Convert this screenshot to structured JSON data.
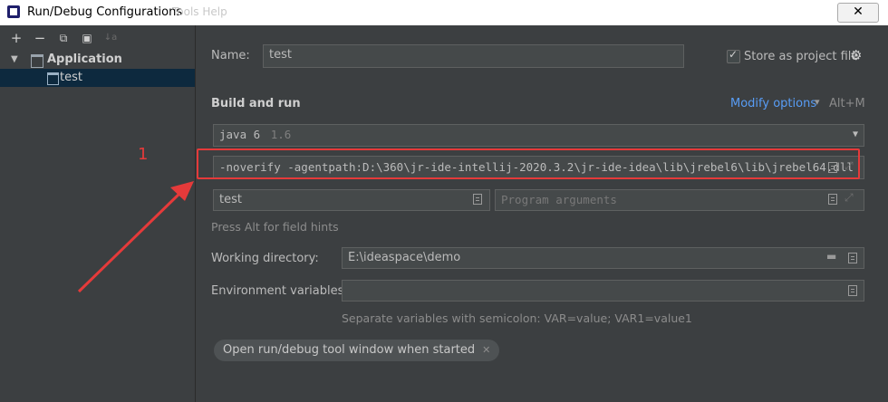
{
  "window": {
    "title": "Run/Debug Configurations",
    "ghost_text": "Tools Help"
  },
  "toolbar": {
    "add": "+",
    "remove": "−",
    "copy": "⧉",
    "folder": "▣",
    "sort": "↓a"
  },
  "tree": {
    "group_label": "Application",
    "item_label": "test"
  },
  "form": {
    "name_label": "Name:",
    "name_value": "test",
    "store_label": "Store as project file",
    "store_checked": true,
    "section_title": "Build and run",
    "modify_options": "Modify options",
    "modify_shortcut": "Alt+M",
    "jdk_name": "java 6",
    "jdk_version": "1.6",
    "vm_options": "-noverify -agentpath:D:\\360\\jr-ide-intellij-2020.3.2\\jr-ide-idea\\lib\\jrebel6\\lib\\jrebel64.dll",
    "main_class": "test",
    "program_args_placeholder": "Program arguments",
    "field_hint": "Press Alt for field hints",
    "working_dir_label": "Working directory:",
    "working_dir_value": "E:\\ideaspace\\demo",
    "env_label": "Environment variables:",
    "env_value": "",
    "env_hint": "Separate variables with semicolon: VAR=value; VAR1=value1",
    "chip_label": "Open run/debug tool window when started"
  },
  "annotation": {
    "number": "1",
    "color": "#e53a3a"
  }
}
